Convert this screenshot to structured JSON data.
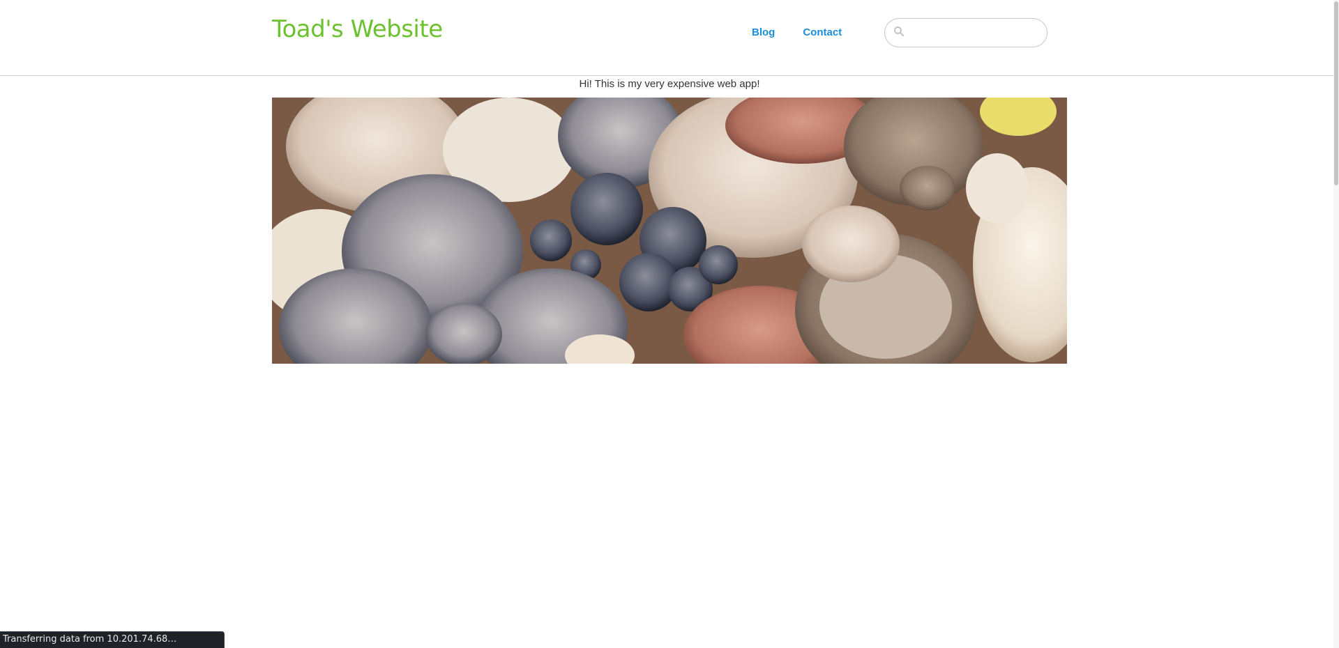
{
  "site": {
    "title": "Toad's Website"
  },
  "nav": {
    "items": [
      {
        "label": "Blog"
      },
      {
        "label": "Contact"
      }
    ]
  },
  "search": {
    "placeholder": "",
    "value": ""
  },
  "tagline": "Hi! This is my very expensive web app!",
  "hero": {
    "alt": "mushrooms-photo"
  },
  "status": {
    "text": "Transferring data from 10.201.74.68…"
  },
  "colors": {
    "title": "#6cc12f",
    "nav_link": "#1a8ed9",
    "header_border": "#d2d2d2",
    "status_bg": "#1f2328"
  },
  "icons": {
    "search": "search-icon"
  }
}
